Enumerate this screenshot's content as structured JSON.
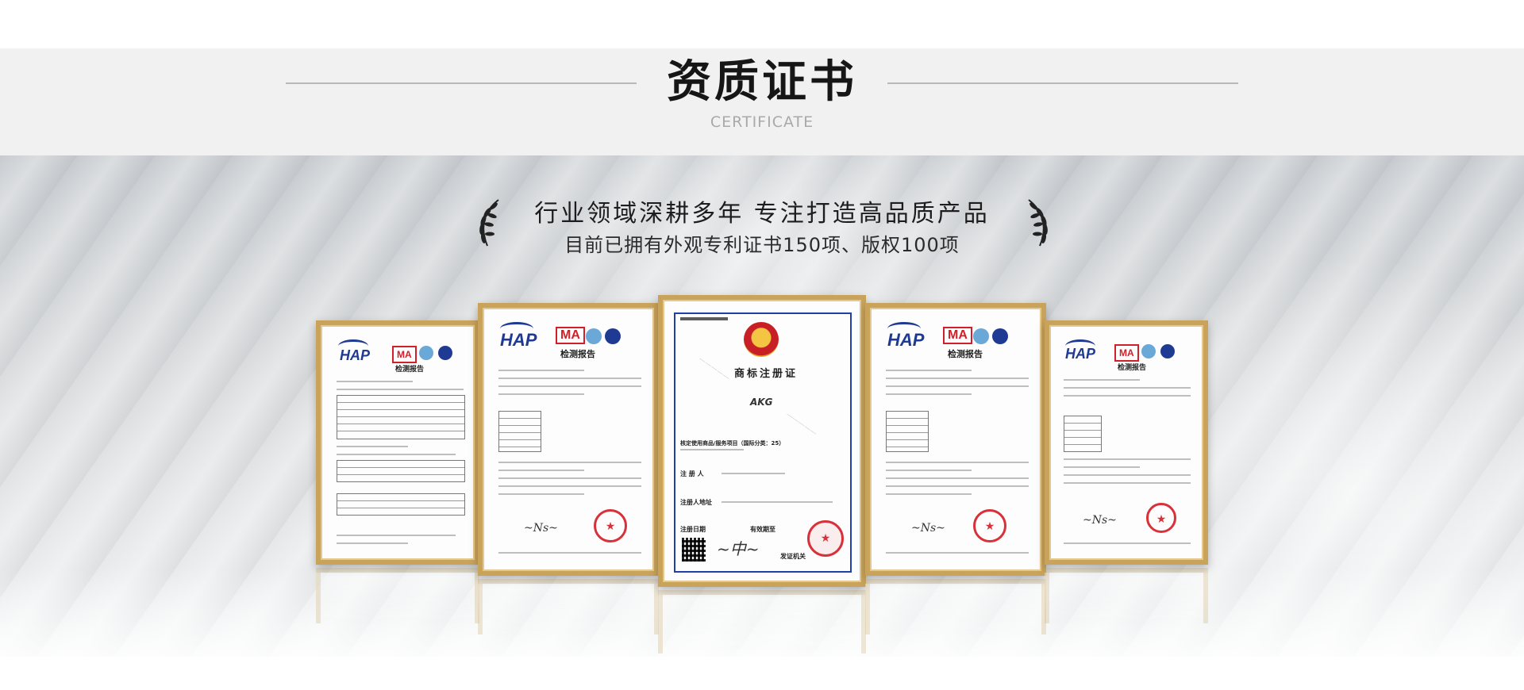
{
  "header": {
    "title": "资质证书",
    "subtitle": "CERTIFICATE"
  },
  "banner": {
    "slogan_line1": "行业领域深耕多年 专注打造高品质产品",
    "slogan_line2": "目前已拥有外观专利证书150项、版权100项"
  },
  "certificates": {
    "test_report": {
      "brand": "HAP",
      "badge": "MA",
      "title": "检测报告"
    },
    "trademark": {
      "title": "商标注册证",
      "mark": "AKG",
      "label_goods": "核定使用商品/服务项目（国际分类：25）",
      "label_registrant": "注 册 人",
      "label_address": "注册人地址",
      "label_date": "注册日期",
      "label_valid": "有效期至",
      "label_authority": "发证机关"
    }
  },
  "colors": {
    "gold_frame": "#c9a35a",
    "seal_red": "#d8313a",
    "brand_blue": "#1f3a93"
  }
}
